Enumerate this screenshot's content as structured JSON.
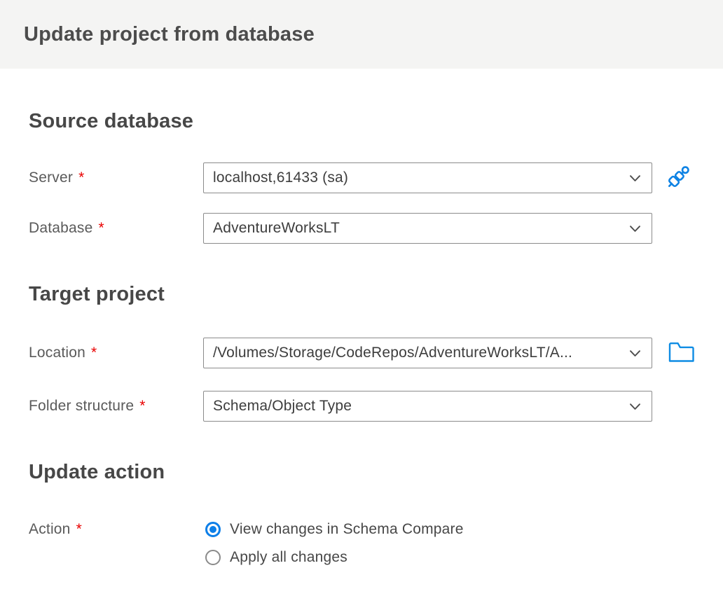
{
  "header": {
    "title": "Update project from database"
  },
  "sections": {
    "source_database": {
      "heading": "Source database"
    },
    "target_project": {
      "heading": "Target project"
    },
    "update_action": {
      "heading": "Update action"
    }
  },
  "fields": {
    "server": {
      "label": "Server",
      "required": "*",
      "value": "localhost,61433 (sa)"
    },
    "database": {
      "label": "Database",
      "required": "*",
      "value": "AdventureWorksLT"
    },
    "location": {
      "label": "Location",
      "required": "*",
      "value": "/Volumes/Storage/CodeRepos/AdventureWorksLT/A..."
    },
    "folder_structure": {
      "label": "Folder structure",
      "required": "*",
      "value": "Schema/Object Type"
    },
    "action": {
      "label": "Action",
      "required": "*",
      "options": [
        {
          "label": "View changes in Schema Compare",
          "selected": true
        },
        {
          "label": "Apply all changes",
          "selected": false
        }
      ]
    }
  },
  "icons": {
    "connect": "plug-connect-icon",
    "browse": "folder-browse-icon",
    "dropdown": "chevron-down-icon",
    "radio_selected": "radio-selected-icon",
    "radio_unselected": "radio-unselected-icon"
  },
  "colors": {
    "accent_blue": "#0d82e4",
    "radio_blue": "#0d7fe8",
    "required_red": "#e90000",
    "header_background": "#f4f4f3",
    "field_border": "#8b8b8b",
    "heading_text": "#474747",
    "label_text": "#5a5a5a",
    "value_text": "#3d3d3d"
  }
}
